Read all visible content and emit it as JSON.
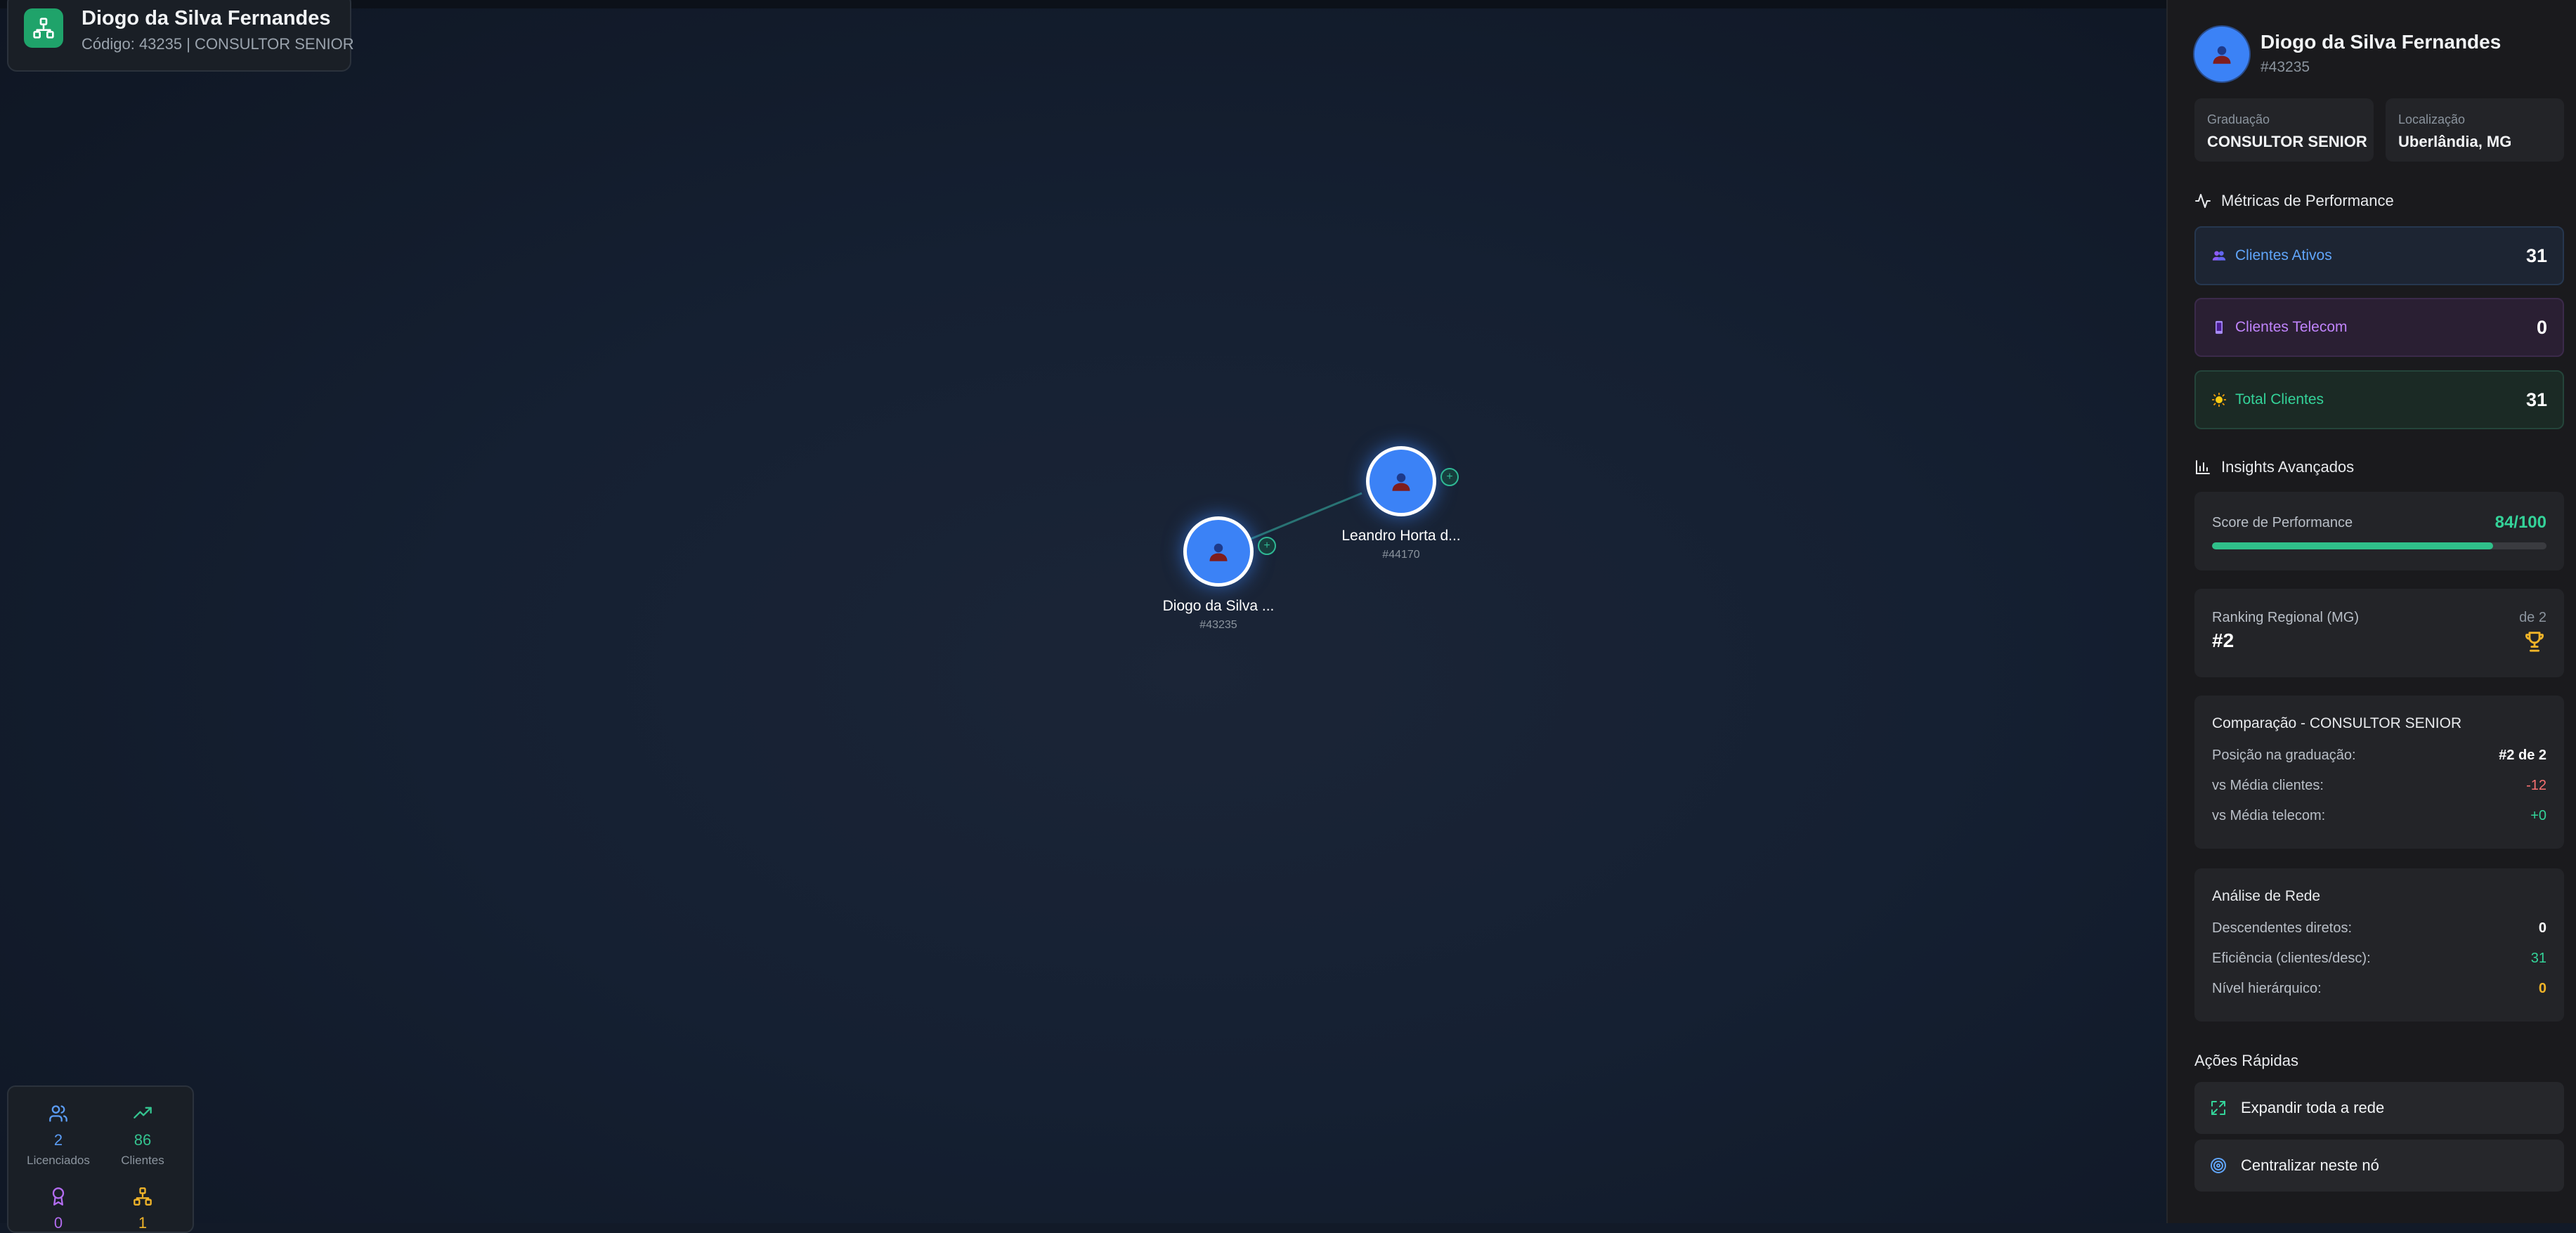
{
  "header": {
    "name": "Diogo da Silva Fernandes",
    "subtitle": "Código: 43235 | CONSULTOR SENIOR"
  },
  "graph": {
    "nodes": [
      {
        "name": "Diogo da Silva ...",
        "code": "#43235"
      },
      {
        "name": "Leandro Horta d...",
        "code": "#44170"
      }
    ],
    "expand_symbol": "+"
  },
  "stats": {
    "items": [
      {
        "value": "2",
        "label": "Licenciados",
        "icon": "users-icon",
        "color": "#5b9cf5"
      },
      {
        "value": "86",
        "label": "Clientes",
        "icon": "trending-up-icon",
        "color": "#34c38f"
      },
      {
        "value": "0",
        "label": "",
        "icon": "award-icon",
        "color": "#b36cf0"
      },
      {
        "value": "1",
        "label": "",
        "icon": "network-icon",
        "color": "#f0b429"
      }
    ]
  },
  "panel": {
    "name": "Diogo da Silva Fernandes",
    "code": "#43235",
    "graduacao_label": "Graduação",
    "graduacao_value": "CONSULTOR SENIOR",
    "localizacao_label": "Localização",
    "localizacao_value": "Uberlândia, MG",
    "metrics_title": "Métricas de Performance",
    "metrics": [
      {
        "label": "Clientes Ativos",
        "value": "31",
        "icon": "people-icon",
        "color": "#60a5fa"
      },
      {
        "label": "Clientes Telecom",
        "value": "0",
        "icon": "phone-icon",
        "color": "#c084fc"
      },
      {
        "label": "Total Clientes",
        "value": "31",
        "icon": "sun-icon",
        "color": "#34d399"
      }
    ],
    "insights_title": "Insights Avançados",
    "score_label": "Score de Performance",
    "score_value": "84/100",
    "score_fraction": 0.84,
    "ranking_label": "Ranking Regional (MG)",
    "ranking_value": "#2",
    "ranking_of": "de 2",
    "comparison_title": "Comparação - CONSULTOR SENIOR",
    "comparison_rows": [
      {
        "label": "Posição na graduação:",
        "value": "#2 de 2",
        "color": "#ffffff"
      },
      {
        "label": "vs Média clientes:",
        "value": "-12",
        "color": "#f87171"
      },
      {
        "label": "vs Média telecom:",
        "value": "+0",
        "color": "#34d399"
      }
    ],
    "network_title": "Análise de Rede",
    "network_rows": [
      {
        "label": "Descendentes diretos:",
        "value": "0",
        "color": "#ffffff"
      },
      {
        "label": "Eficiência (clientes/desc):",
        "value": "31",
        "color": "#34d399"
      },
      {
        "label": "Nível hierárquico:",
        "value": "0",
        "color": "#f0b429"
      }
    ],
    "actions_title": "Ações Rápidas",
    "actions": [
      {
        "label": "Expandir toda a rede",
        "icon": "expand-icon"
      },
      {
        "label": "Centralizar neste nó",
        "icon": "target-icon"
      }
    ]
  }
}
